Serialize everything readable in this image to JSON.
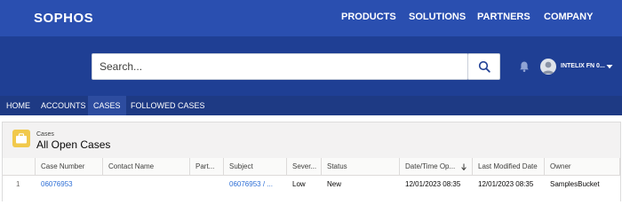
{
  "brand": "SOPHOS",
  "top_nav": [
    "PRODUCTS",
    "SOLUTIONS",
    "PARTNERS",
    "COMPANY"
  ],
  "search": {
    "placeholder": "Search...",
    "icon": "search-icon"
  },
  "header": {
    "notification_icon": "bell-icon",
    "user_name": "INTELIX FN 0...",
    "user_caret": "chevron-down-icon"
  },
  "sub_nav": [
    {
      "label": "HOME",
      "active": false
    },
    {
      "label": "ACCOUNTS",
      "active": false
    },
    {
      "label": "CASES",
      "active": true
    },
    {
      "label": "FOLLOWED CASES",
      "active": false
    }
  ],
  "list_view": {
    "object_label": "Cases",
    "title": "All Open Cases",
    "icon": "briefcase-icon",
    "icon_color": "#f1c94c",
    "columns": [
      "Case Number",
      "Contact Name",
      "Part...",
      "Subject",
      "Sever...",
      "Status",
      "Date/Time Op...",
      "Last Modified Date",
      "Owner"
    ],
    "sorted_column": "Date/Time Op...",
    "rows": [
      {
        "index": "1",
        "case_number": "06076953",
        "contact_name": "",
        "part": "",
        "subject": "06076953 / ...",
        "severity": "Low",
        "status": "New",
        "date_opened": "12/01/2023 08:35",
        "last_modified": "12/01/2023 08:35",
        "owner": "SamplesBucket"
      }
    ]
  },
  "colors": {
    "top_bar": "#2a4fb0",
    "hero": "#1f3f94",
    "sub_nav": "#1e3a84",
    "link": "#2e6fd6"
  }
}
